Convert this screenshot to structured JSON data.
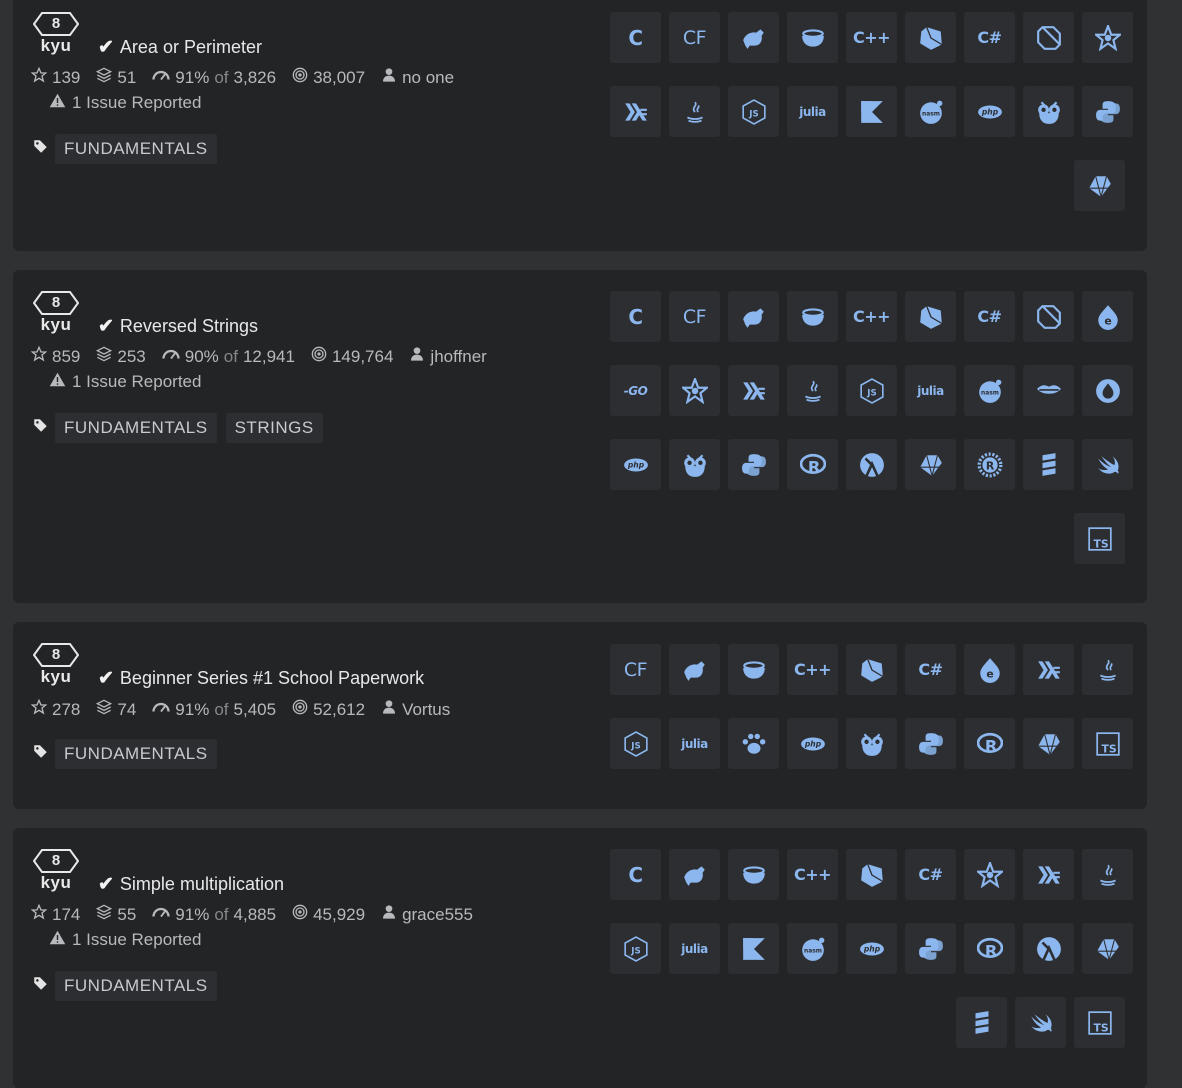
{
  "katas": [
    {
      "rank_num": "8",
      "rank_unit": "kyu",
      "title": "Area or Perimeter",
      "stars": "139",
      "collections": "51",
      "satisfaction": "91%",
      "of_label": "of",
      "votes": "3,826",
      "completed": "38,007",
      "author": "no one",
      "issue": "1 Issue Reported",
      "tags": [
        "FUNDAMENTALS"
      ],
      "languages": [
        "c",
        "coffeescript",
        "elixir",
        "cpp-bowl",
        "cpp",
        "crystal",
        "csharp",
        "dart",
        "elm",
        "haskell",
        "java",
        "javascript",
        "julia",
        "kotlin",
        "nasm",
        "php",
        "ocaml",
        "python",
        "ruby"
      ]
    },
    {
      "rank_num": "8",
      "rank_unit": "kyu",
      "title": "Reversed Strings",
      "stars": "859",
      "collections": "253",
      "satisfaction": "90%",
      "of_label": "of",
      "votes": "12,941",
      "completed": "149,764",
      "author": "jhoffner",
      "issue": "1 Issue Reported",
      "tags": [
        "FUNDAMENTALS",
        "STRINGS"
      ],
      "languages": [
        "c",
        "coffeescript",
        "elixir",
        "cpp-bowl",
        "cpp",
        "crystal",
        "csharp",
        "dart",
        "erlang",
        "go",
        "elm",
        "haskell",
        "java",
        "javascript",
        "julia",
        "nasm",
        "lips",
        "fsharp",
        "php",
        "ocaml",
        "python",
        "r",
        "racket",
        "ruby",
        "rust",
        "scala",
        "swift",
        "typescript"
      ]
    },
    {
      "rank_num": "8",
      "rank_unit": "kyu",
      "title": "Beginner Series #1 School Paperwork",
      "stars": "278",
      "collections": "74",
      "satisfaction": "91%",
      "of_label": "of",
      "votes": "5,405",
      "completed": "52,612",
      "author": "Vortus",
      "issue": "",
      "tags": [
        "FUNDAMENTALS"
      ],
      "languages": [
        "coffeescript",
        "elixir",
        "cpp-bowl",
        "cpp",
        "crystal",
        "csharp",
        "erlang",
        "haskell",
        "java",
        "javascript",
        "julia",
        "paw",
        "php",
        "ocaml",
        "python",
        "r",
        "ruby",
        "typescript"
      ]
    },
    {
      "rank_num": "8",
      "rank_unit": "kyu",
      "title": "Simple multiplication",
      "stars": "174",
      "collections": "55",
      "satisfaction": "91%",
      "of_label": "of",
      "votes": "4,885",
      "completed": "45,929",
      "author": "grace555",
      "issue": "1 Issue Reported",
      "tags": [
        "FUNDAMENTALS"
      ],
      "languages": [
        "c",
        "elixir",
        "cpp-bowl",
        "cpp",
        "crystal",
        "csharp",
        "elm",
        "haskell",
        "java",
        "javascript",
        "julia",
        "kotlin",
        "nasm",
        "php",
        "python",
        "r",
        "racket",
        "ruby",
        "scala",
        "swift",
        "typescript"
      ]
    }
  ],
  "icon_text": {
    "c": "C",
    "coffeescript": "CF",
    "cpp": "C++",
    "csharp": "C#",
    "julia": "julia",
    "php": "php",
    "go": "GO",
    "nasm": "nasm",
    "typescript": "TS",
    "haskell": "⪢",
    "javascript": "JS",
    "kotlin": "K",
    "r": "R"
  },
  "colors": {
    "accent": "#8bb6ee",
    "card": "#232426",
    "page": "#303133"
  }
}
